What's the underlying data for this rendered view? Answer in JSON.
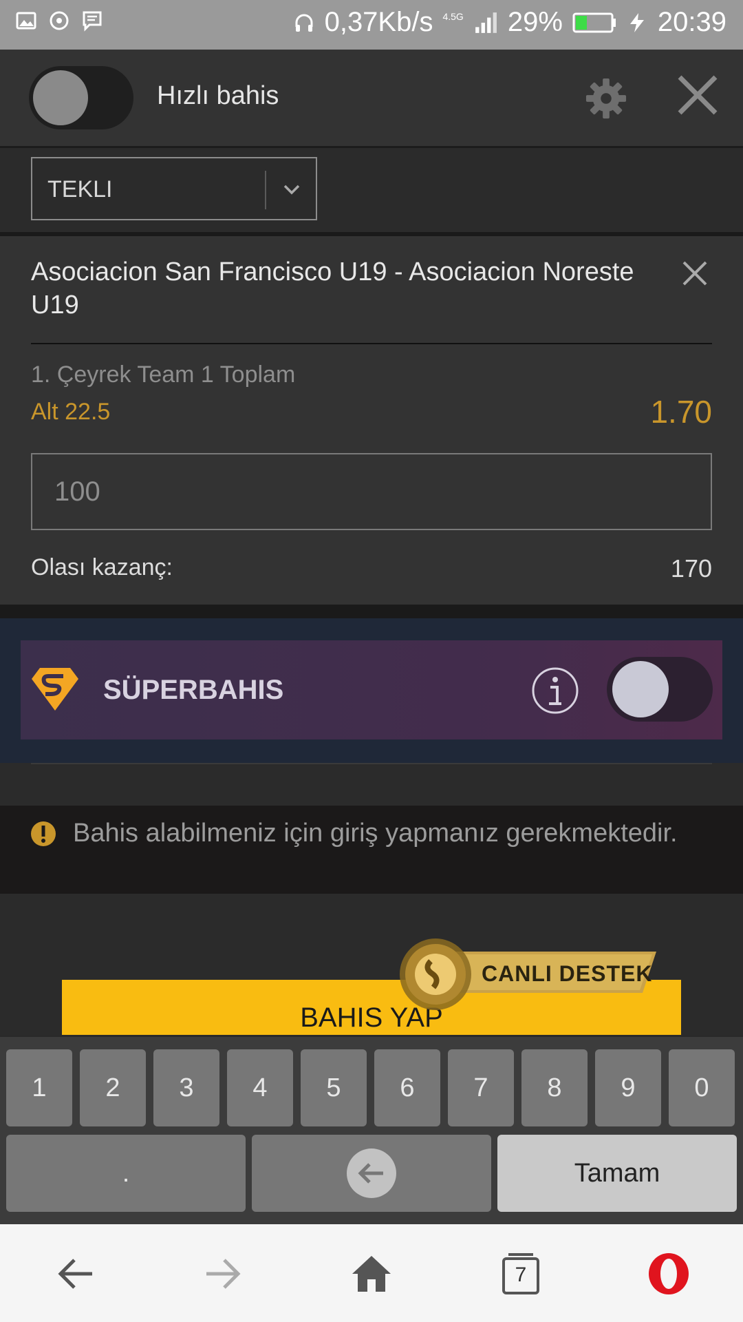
{
  "status_bar": {
    "speed": "0,37Kb/s",
    "network": "4.5G",
    "battery": "29%",
    "time": "20:39"
  },
  "header": {
    "quick_bet_label": "Hızlı bahis"
  },
  "bet_type": {
    "selected": "TEKLI"
  },
  "bet": {
    "match": "Asociacion San Francisco U19 - Asociacion Noreste U19",
    "market": "1. Çeyrek Team 1 Toplam",
    "selection": "Alt 22.5",
    "odds": "1.70",
    "stake_placeholder": "100",
    "possible_win_label": "Olası kazanç:",
    "possible_win_value": "170"
  },
  "superbahis": {
    "title": "SÜPERBAHIS"
  },
  "warning": {
    "text": "Bahis alabilmeniz için giriş yapmanız gerekmektedir."
  },
  "bet_button": {
    "label": "BAHIS YAP"
  },
  "support": {
    "label": "CANLI DESTEK"
  },
  "keyboard": {
    "digits": [
      "1",
      "2",
      "3",
      "4",
      "5",
      "6",
      "7",
      "8",
      "9",
      "0"
    ],
    "dot": ".",
    "done": "Tamam"
  },
  "navbar": {
    "tabs_count": "7"
  },
  "colors": {
    "accent_gold": "#c9962b",
    "bet_button": "#f9bc11",
    "opera_red": "#e0141e"
  }
}
